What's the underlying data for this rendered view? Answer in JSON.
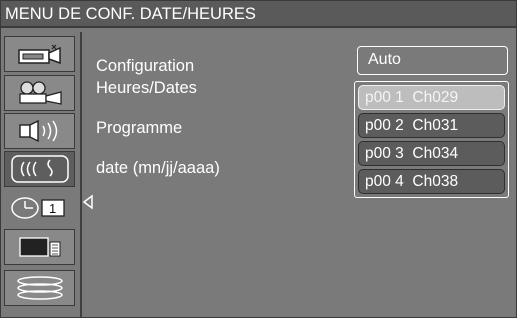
{
  "header": {
    "title": "MENU DE CONF. DATE/HEURES"
  },
  "sidebar": {
    "items": [
      {
        "icon": "camcorder-icon"
      },
      {
        "icon": "projector-icon"
      },
      {
        "icon": "speaker-icon"
      },
      {
        "icon": "antenna-signal-icon"
      },
      {
        "icon": "clock-icon",
        "badge": "1"
      },
      {
        "icon": "tv-remote-icon"
      },
      {
        "icon": "disc-stack-icon"
      }
    ]
  },
  "main": {
    "config_label_line1": "Configuration",
    "config_label_line2": "Heures/Dates",
    "programme_label": "Programme",
    "date_label": "date (mn/jj/aaaa)",
    "config_value": "Auto",
    "programmes": [
      {
        "label": "p00 1  Ch029",
        "selected": true
      },
      {
        "label": "p00 2  Ch031",
        "selected": false
      },
      {
        "label": "p00 3  Ch034",
        "selected": false
      },
      {
        "label": "p00 4  Ch038",
        "selected": false
      }
    ]
  },
  "colors": {
    "background": "#7a7a7a",
    "title_bar": "#5a5a5a",
    "selected": "#bdbdbd",
    "item": "#5c5c5c",
    "text": "#ffffff"
  }
}
